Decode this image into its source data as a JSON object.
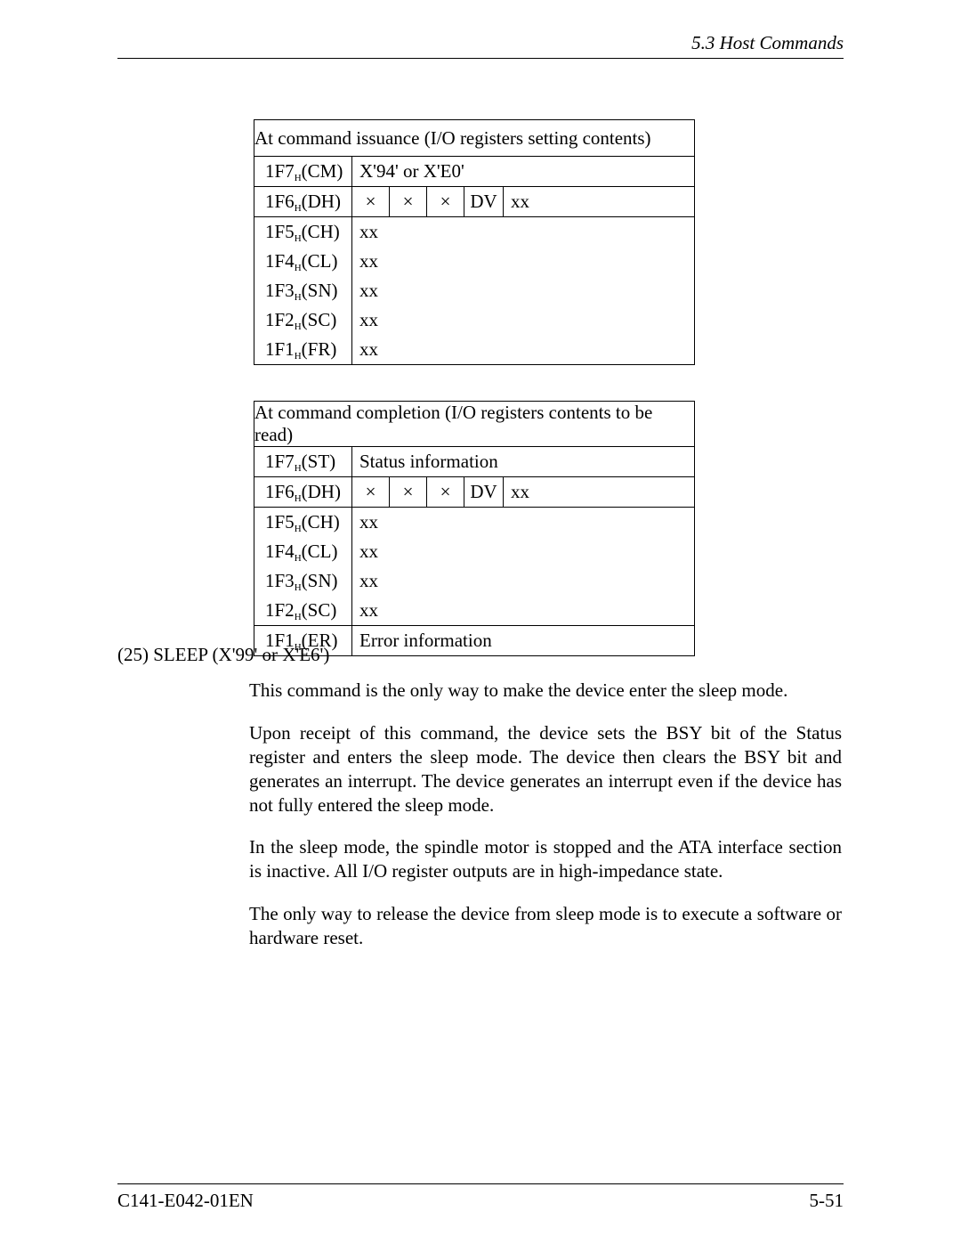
{
  "header": {
    "section": "5.3  Host Commands"
  },
  "table1": {
    "caption": "At command issuance (I/O registers setting contents)",
    "rows": {
      "cm": {
        "addr": "1F7",
        "reg": "(CM)",
        "value": "X'94' or X'E0'"
      },
      "dh": {
        "addr": "1F6",
        "reg": "(DH)",
        "b7": "×",
        "b6": "×",
        "b5": "×",
        "b4": "DV",
        "rest": "xx"
      },
      "ch": {
        "addr": "1F5",
        "reg": "(CH)",
        "value": "xx"
      },
      "cl": {
        "addr": "1F4",
        "reg": "(CL)",
        "value": "xx"
      },
      "sn": {
        "addr": "1F3",
        "reg": "(SN)",
        "value": "xx"
      },
      "sc": {
        "addr": "1F2",
        "reg": "(SC)",
        "value": "xx"
      },
      "fr": {
        "addr": "1F1",
        "reg": "(FR)",
        "value": "xx"
      }
    }
  },
  "table2": {
    "caption": "At command completion (I/O registers contents to be read)",
    "rows": {
      "st": {
        "addr": "1F7",
        "reg": "(ST)",
        "value": "Status information"
      },
      "dh": {
        "addr": "1F6",
        "reg": "(DH)",
        "b7": "×",
        "b6": "×",
        "b5": "×",
        "b4": "DV",
        "rest": "xx"
      },
      "ch": {
        "addr": "1F5",
        "reg": "(CH)",
        "value": "xx"
      },
      "cl": {
        "addr": "1F4",
        "reg": "(CL)",
        "value": "xx"
      },
      "sn": {
        "addr": "1F3",
        "reg": "(SN)",
        "value": "xx"
      },
      "sc": {
        "addr": "1F2",
        "reg": "(SC)",
        "value": "xx"
      },
      "er": {
        "addr": "1F1",
        "reg": "(ER)",
        "value": "Error information"
      }
    }
  },
  "heading": "(25)  SLEEP (X'99' or X'E6')",
  "paras": {
    "p1": "This command is the only way to make the device enter the sleep mode.",
    "p2": "Upon receipt of this command, the device sets the BSY bit of the Status register and enters the sleep mode.  The device then clears the BSY bit and generates an interrupt. The device generates an interrupt even if the device has not fully entered the sleep mode.",
    "p3": "In the sleep mode, the spindle motor is stopped and the ATA interface section is inactive.  All I/O register outputs are in high-impedance state.",
    "p4": "The only way to release the device from sleep mode is to execute a software or hardware reset."
  },
  "footer": {
    "doc": "C141-E042-01EN",
    "page": "5-51"
  },
  "sub": "H"
}
